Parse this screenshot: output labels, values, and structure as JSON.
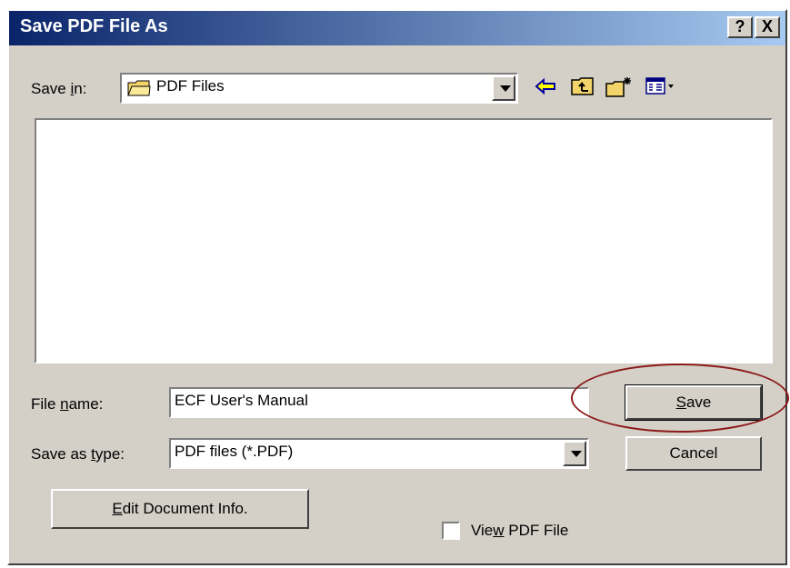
{
  "dialog": {
    "title": "Save PDF File As",
    "help_button": "?",
    "close_button": "X"
  },
  "save_in": {
    "label_pre": "Save ",
    "label_accel": "i",
    "label_post": "n:",
    "value": "PDF Files"
  },
  "toolbar": {
    "icons": [
      "back-icon",
      "up-one-level-icon",
      "new-folder-icon",
      "view-menu-icon"
    ]
  },
  "file_name": {
    "label_pre": "File ",
    "label_accel": "n",
    "label_post": "ame:",
    "value": "ECF User's Manual"
  },
  "save_as_type": {
    "label_pre": "Save as ",
    "label_accel": "t",
    "label_post": "ype:",
    "value": "PDF files (*.PDF)"
  },
  "buttons": {
    "save_accel": "S",
    "save_rest": "ave",
    "cancel": "Cancel",
    "edit_info_accel": "E",
    "edit_info_rest": "dit Document Info."
  },
  "view_pdf": {
    "label_pre": "Vie",
    "label_accel": "w",
    "label_post": " PDF File",
    "checked": false
  },
  "colors": {
    "title_bar": "#0a246a",
    "dialog_face": "#d4d0c8",
    "annotation_ellipse": "#8b1a1a"
  }
}
